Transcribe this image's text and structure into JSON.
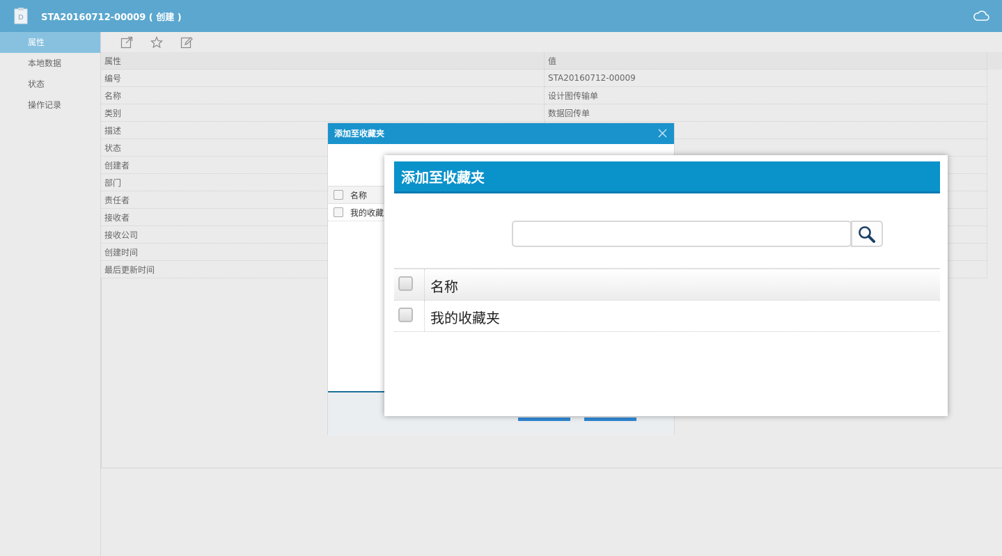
{
  "window": {
    "title": "STA20160712-00009 ( 创建 )"
  },
  "sidebar": {
    "items": [
      "属性",
      "本地数据",
      "状态",
      "操作记录"
    ],
    "active_index": 0
  },
  "toolbar": {
    "icons": [
      "external-link-icon",
      "star-icon",
      "edit-icon"
    ]
  },
  "properties": {
    "headers": [
      "属性",
      "值"
    ],
    "rows": [
      [
        "编号",
        "STA20160712-00009"
      ],
      [
        "名称",
        "设计图传输单"
      ],
      [
        "类别",
        "数据回传单"
      ],
      [
        "描述",
        ""
      ],
      [
        "状态",
        ""
      ],
      [
        "创建者",
        ""
      ],
      [
        "部门",
        ""
      ],
      [
        "责任者",
        ""
      ],
      [
        "接收者",
        ""
      ],
      [
        "接收公司",
        ""
      ],
      [
        "创建时间",
        ""
      ],
      [
        "最后更新时间",
        ""
      ]
    ]
  },
  "dialog_back": {
    "title": "添加至收藏夹",
    "header_name": "名称",
    "item": "我的收藏"
  },
  "dialog_front": {
    "title": "添加至收藏夹",
    "search_placeholder": "",
    "header_name": "名称",
    "items": [
      "我的收藏夹"
    ]
  },
  "colors": {
    "titlebar": "#5ba7cf",
    "sidebar_active": "#87c1df",
    "dialog_header": "#0a92cb"
  }
}
